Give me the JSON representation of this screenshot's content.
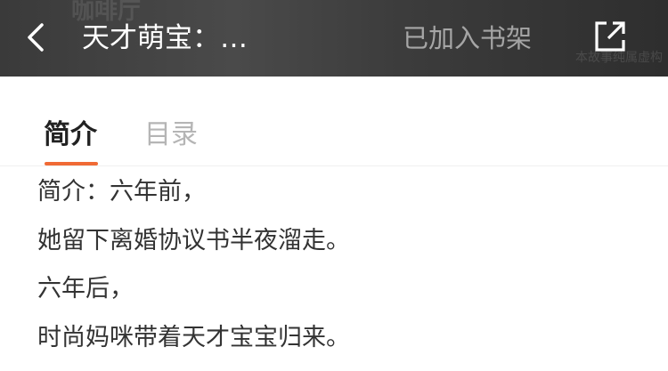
{
  "header": {
    "back_icon": "chevron-left-icon",
    "title": "天才萌宝：…",
    "add_to_shelf_label": "已加入书架",
    "share_icon": "share-external-icon",
    "cover_text": "咖啡厅",
    "stamp_text": "本故事纯属虚构"
  },
  "tabs": [
    {
      "label": "简介",
      "active": true
    },
    {
      "label": "目录",
      "active": false
    }
  ],
  "accent_color": "#f06a35",
  "synopsis": {
    "lines": [
      "简介：六年前，",
      "她留下离婚协议书半夜溜走。",
      "六年后，",
      "时尚妈咪带着天才宝宝归来。"
    ]
  }
}
